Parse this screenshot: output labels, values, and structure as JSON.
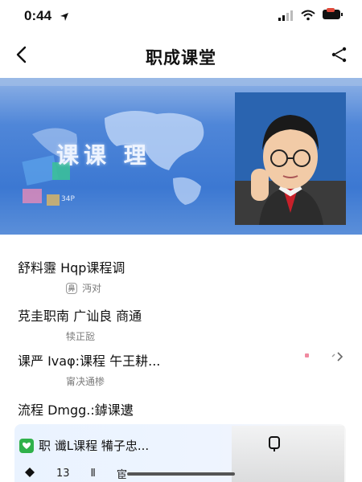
{
  "status": {
    "time": "0:44"
  },
  "nav": {
    "title": "职成课堂"
  },
  "banner": {
    "text": "课课 理",
    "badge": "34P"
  },
  "list": [
    {
      "title": "舒料靋 Hqp课程调",
      "meta": "沔对",
      "meta_icon": "nose-icon"
    },
    {
      "title": "莌圭职南 广讪良 商通",
      "meta": "犊正瓰",
      "meta_icon": ""
    },
    {
      "title": "课严 Ivaφ:课程 午王耕...",
      "meta": "甯决通椮",
      "meta_icon": ""
    },
    {
      "title": "流程 Dmgg.:鏬课遱",
      "meta": "",
      "meta_icon": ""
    }
  ],
  "promo": {
    "text": "职 谶L课程 犕子忠..."
  },
  "bottom": {
    "item1": "13",
    "item2": "Ⅱ",
    "item3": "宦"
  },
  "colors": {
    "accent": "#3c78d2",
    "wechat": "#2fb14a"
  }
}
